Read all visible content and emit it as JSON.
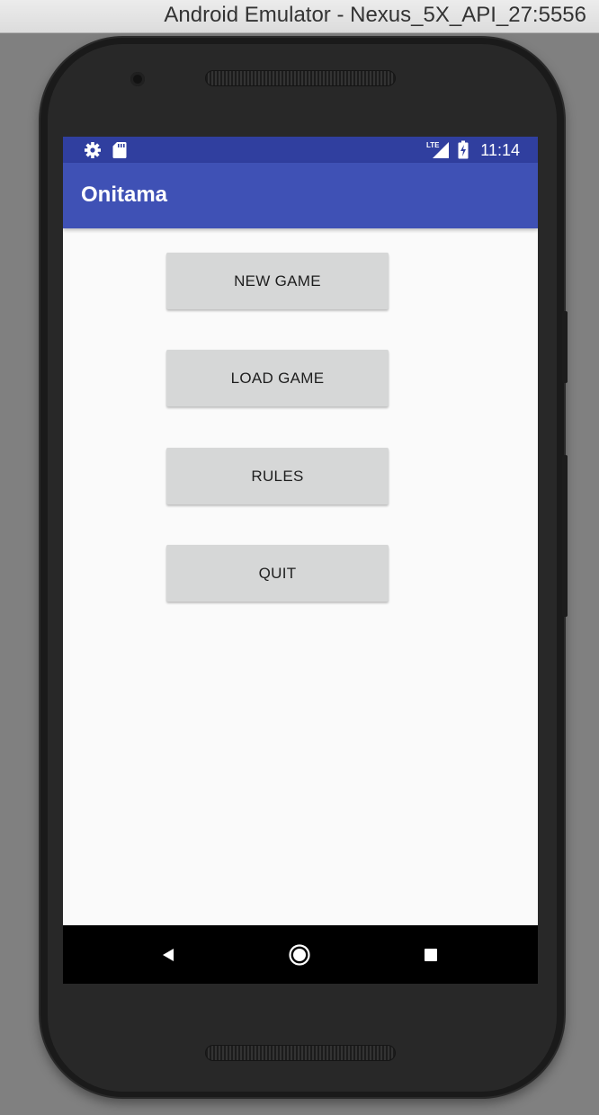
{
  "window": {
    "title": "Android Emulator - Nexus_5X_API_27:5556"
  },
  "status_bar": {
    "time": "11:14",
    "network_label": "LTE",
    "icons": [
      "settings-icon",
      "sd-card-icon",
      "lte-signal-icon",
      "battery-charging-icon"
    ],
    "color": "#303f9f"
  },
  "app_bar": {
    "title": "Onitama",
    "color": "#3f51b5"
  },
  "menu": {
    "new_game": "NEW GAME",
    "load_game": "LOAD GAME",
    "rules": "RULES",
    "quit": "QUIT"
  },
  "nav_bar": {
    "icons": [
      "back-icon",
      "home-icon",
      "recents-icon"
    ]
  }
}
